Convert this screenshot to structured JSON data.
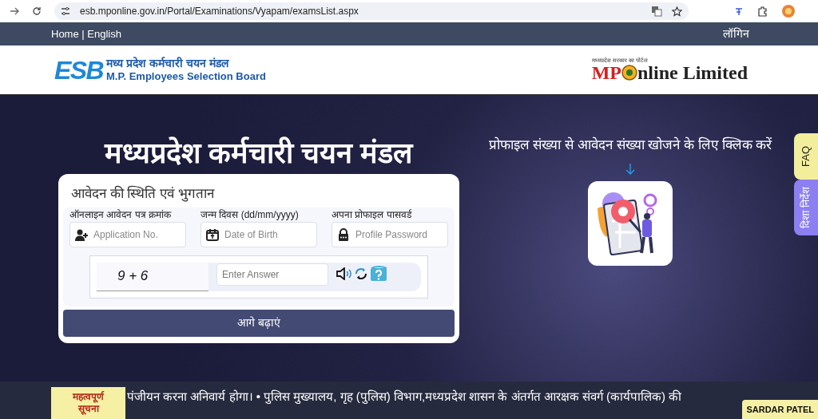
{
  "browser": {
    "url": "esb.mponline.gov.in/Portal/Examinations/Vyapam/examsList.aspx"
  },
  "nav": {
    "left": "Home | English",
    "right": "लॉगिन"
  },
  "header": {
    "left_logo": {
      "mark": "ESB",
      "title_hi": "मध्य प्रदेश कर्मचारी चयन मंडल",
      "title_en": "M.P. Employees Selection Board"
    },
    "right_logo": {
      "kicker": "मध्यप्रदेश सरकार का पोर्टल",
      "brand_a": "MP",
      "brand_b": "nline Limited"
    }
  },
  "hero": {
    "heading": "मध्यप्रदेश कर्मचारी चयन मंडल",
    "form": {
      "title": "आवेदन की स्थिति एवं भुगतान",
      "fields": [
        {
          "kind": "user",
          "label": "ऑनलाइन आवेदन पत्र क्रमांक",
          "placeholder": "Application No."
        },
        {
          "kind": "calendar",
          "label": "जन्म दिवस (dd/mm/yyyy)",
          "placeholder": "Date of Birth"
        },
        {
          "kind": "lock",
          "label": "अपना प्रोफाइल पासवर्ड",
          "placeholder": "Profile Password"
        }
      ],
      "captcha": {
        "question": "9 + 6",
        "placeholder": "Enter Answer"
      },
      "submit": "आगे बढ़ाएं"
    },
    "search_link": "प्रोफाइल संख्या से आवेदन संख्या खोजने के लिए क्लिक करें"
  },
  "side_tabs": [
    {
      "label": "FAQ",
      "color": "#f3ee9c"
    },
    {
      "label": "दिशा निर्देश",
      "color": "#8c7ff2"
    }
  ],
  "ticker": {
    "label_lines": [
      "महत्वपूर्ण",
      "सूचना"
    ],
    "text": "पंजीयन करना अनिवार्य होगा। • पुलिस मुख्यालय, गृह (पुलिस) विभाग,मध्यप्रदेश शासन के अंतर्गत आरक्षक संवर्ग (कार्यपालिक) की",
    "badge": "SARDAR PATEL"
  }
}
